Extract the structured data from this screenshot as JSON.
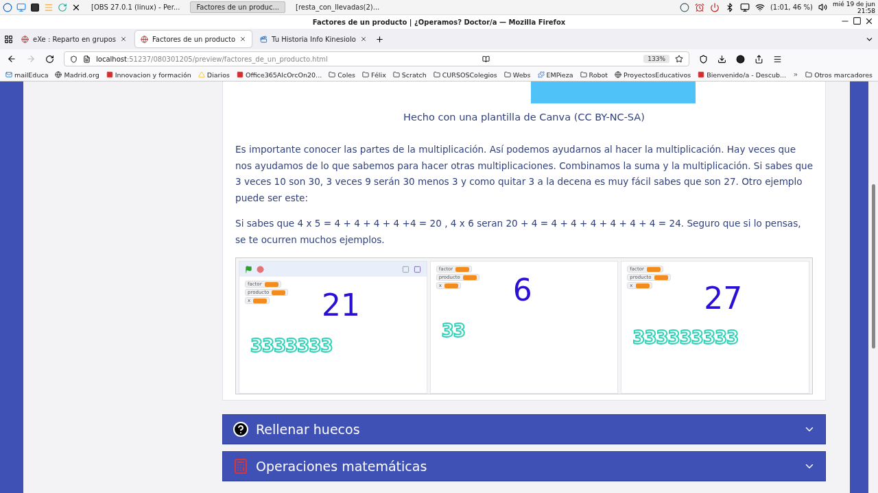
{
  "taskbar": {
    "tasks": [
      {
        "label": "[OBS 27.0.1 (linux) - Per...",
        "selected": false
      },
      {
        "label": "Factores de un produc...",
        "selected": true
      },
      {
        "label": "[resta_con_llevadas(2)...",
        "selected": false
      }
    ],
    "battery": "(1:01, 46 %)",
    "date": "mié 19 de jun",
    "time": "21:58"
  },
  "window": {
    "title": "Factores de un producto | ¿Operamos? Doctor/a — Mozilla Firefox"
  },
  "tabs": [
    {
      "label": "eXe : Reparto en grupos",
      "selected": false
    },
    {
      "label": "Factores de un producto",
      "selected": true
    },
    {
      "label": "Tu Historia Info Kinesiolo",
      "selected": false
    }
  ],
  "address": {
    "host": "localhost",
    "path": ":51237/080301205/preview/factores_de_un_producto.html",
    "zoom": "133%"
  },
  "bookmarks": [
    {
      "label": "mailEduca",
      "kind": "mail"
    },
    {
      "label": "Madrid.org",
      "kind": "globe"
    },
    {
      "label": "Innovacion y formación",
      "kind": "site"
    },
    {
      "label": "Diarios",
      "kind": "drive"
    },
    {
      "label": "Office365AlcOrcOn20...",
      "kind": "site"
    },
    {
      "label": "Coles",
      "kind": "folder"
    },
    {
      "label": "Félix",
      "kind": "folder"
    },
    {
      "label": "Scratch",
      "kind": "folder"
    },
    {
      "label": "CURSOSColegios",
      "kind": "folder"
    },
    {
      "label": "Webs",
      "kind": "folder"
    },
    {
      "label": "EMPieza",
      "kind": "puzzle"
    },
    {
      "label": "Robot",
      "kind": "folder"
    },
    {
      "label": "ProyectosEducativos",
      "kind": "globe"
    },
    {
      "label": "Bienvenido/a - Descub...",
      "kind": "site"
    }
  ],
  "other_bookmarks": "Otros marcadores",
  "content": {
    "caption": "Hecho con una plantilla de Canva (CC BY-NC-SA)",
    "paragraphs": [
      "Es importante conocer las partes de la multiplicación. Así podemos ayudarnos al hacer la multiplicación. Hay veces que nos ayudamos de lo que sabemos para hacer otras multiplicaciones. Combinamos la suma y la multiplicación. Si sabes que 3 veces 10 son 30, 3 veces 9 serán 30 menos 3 y como quitar 3 a la decena es muy fácil sabes que son 27. Otro ejemplo puede ser este:",
      "Si sabes que 4 x 5 = 4 + 4 + 4 + 4 +4 = 20 , 4 x 6 seran 20 + 4 = 4 + 4 + 4 + 4 + 4 + 4 = 24. Seguro que si lo pensas, se te ocurren muchos ejemplos."
    ],
    "projects": [
      {
        "toolbar": true,
        "variables": [
          "factor",
          "producto",
          "x"
        ],
        "result": "21",
        "sprites": "3333333"
      },
      {
        "toolbar": false,
        "variables": [
          "factor",
          "producto",
          "x"
        ],
        "result": "6",
        "sprites": "33"
      },
      {
        "toolbar": false,
        "variables": [
          "factor",
          "producto",
          "x"
        ],
        "result": "27",
        "sprites": "333333333"
      }
    ],
    "accordions": [
      {
        "title": "Rellenar huecos",
        "kind": "question",
        "expanded": false
      },
      {
        "title": "Operaciones matemáticas",
        "kind": "calc",
        "expanded": false
      }
    ]
  }
}
